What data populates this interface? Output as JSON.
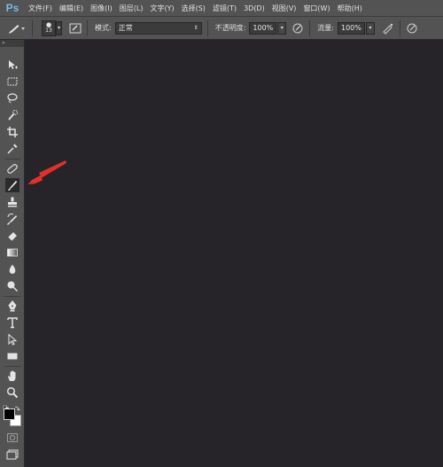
{
  "menubar": {
    "logo": "Ps",
    "items": [
      "文件(F)",
      "编辑(E)",
      "图像(I)",
      "图层(L)",
      "文字(Y)",
      "选择(S)",
      "滤镜(T)",
      "3D(D)",
      "视图(V)",
      "窗口(W)",
      "帮助(H)"
    ]
  },
  "options": {
    "brush_size": "13",
    "mode_label": "模式:",
    "mode_value": "正常",
    "opacity_label": "不透明度:",
    "opacity_value": "100%",
    "flow_label": "流量:",
    "flow_value": "100%"
  },
  "toolbar": {
    "collapse_glyph": "»",
    "tools": [
      "move-tool",
      "marquee-tool",
      "lasso-tool",
      "quick-selection-tool",
      "crop-tool",
      "eyedropper-tool",
      "healing-brush-tool",
      "brush-tool",
      "clone-stamp-tool",
      "history-brush-tool",
      "eraser-tool",
      "gradient-tool",
      "blur-tool",
      "dodge-tool",
      "pen-tool",
      "type-tool",
      "path-selection-tool",
      "rectangle-tool",
      "hand-tool",
      "zoom-tool"
    ],
    "active_tool": "brush-tool",
    "foreground_color": "#000000",
    "background_color": "#ffffff"
  },
  "annotation": {
    "arrow_color": "#e0302a"
  }
}
